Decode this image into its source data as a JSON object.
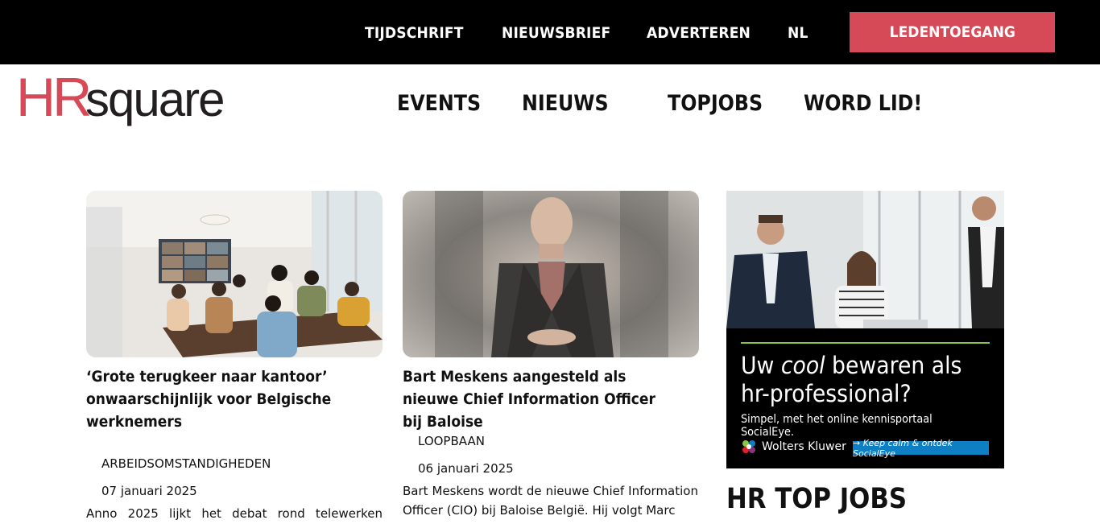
{
  "topbar": {
    "links": [
      "TIJDSCHRIFT",
      "NIEUWSBRIEF",
      "ADVERTEREN",
      "NL"
    ],
    "login_label": "LEDENTOEGANG"
  },
  "logo": {
    "text_hr": "HR",
    "text_square": "square",
    "color_hr": "#d64a58",
    "color_square": "#231f20"
  },
  "mainnav": {
    "items": [
      "EVENTS",
      "NIEUWS",
      "TOPJOBS",
      "WORD LID!"
    ]
  },
  "articles": [
    {
      "title": "‘Grote terugkeer naar kantoor’ onwaarschijnlijk voor Belgische werknemers",
      "category": "ARBEIDSOMSTANDIGHEDEN",
      "date": "07 januari 2025",
      "excerpt": "Anno 2025 lijkt het debat rond telewerken"
    },
    {
      "title": "Bart Meskens aangesteld als nieuwe Chief Information Officer bij Baloise",
      "category": "LOOPBAAN",
      "date": "06 januari 2025",
      "excerpt": "Bart Meskens wordt de nieuwe Chief Information Officer (CIO) bij Baloise België. Hij volgt Marc"
    }
  ],
  "ad": {
    "headline_1": "Uw ",
    "headline_em": "cool",
    "headline_2": " bewaren als hr-professional?",
    "sub": "Simpel, met het online kennisportaal SocialEye.",
    "brand": "Wolters Kluwer",
    "cta": "→ Keep calm & ontdek SocialEye"
  },
  "sidebar": {
    "section_title": "HR TOP JOBS"
  }
}
